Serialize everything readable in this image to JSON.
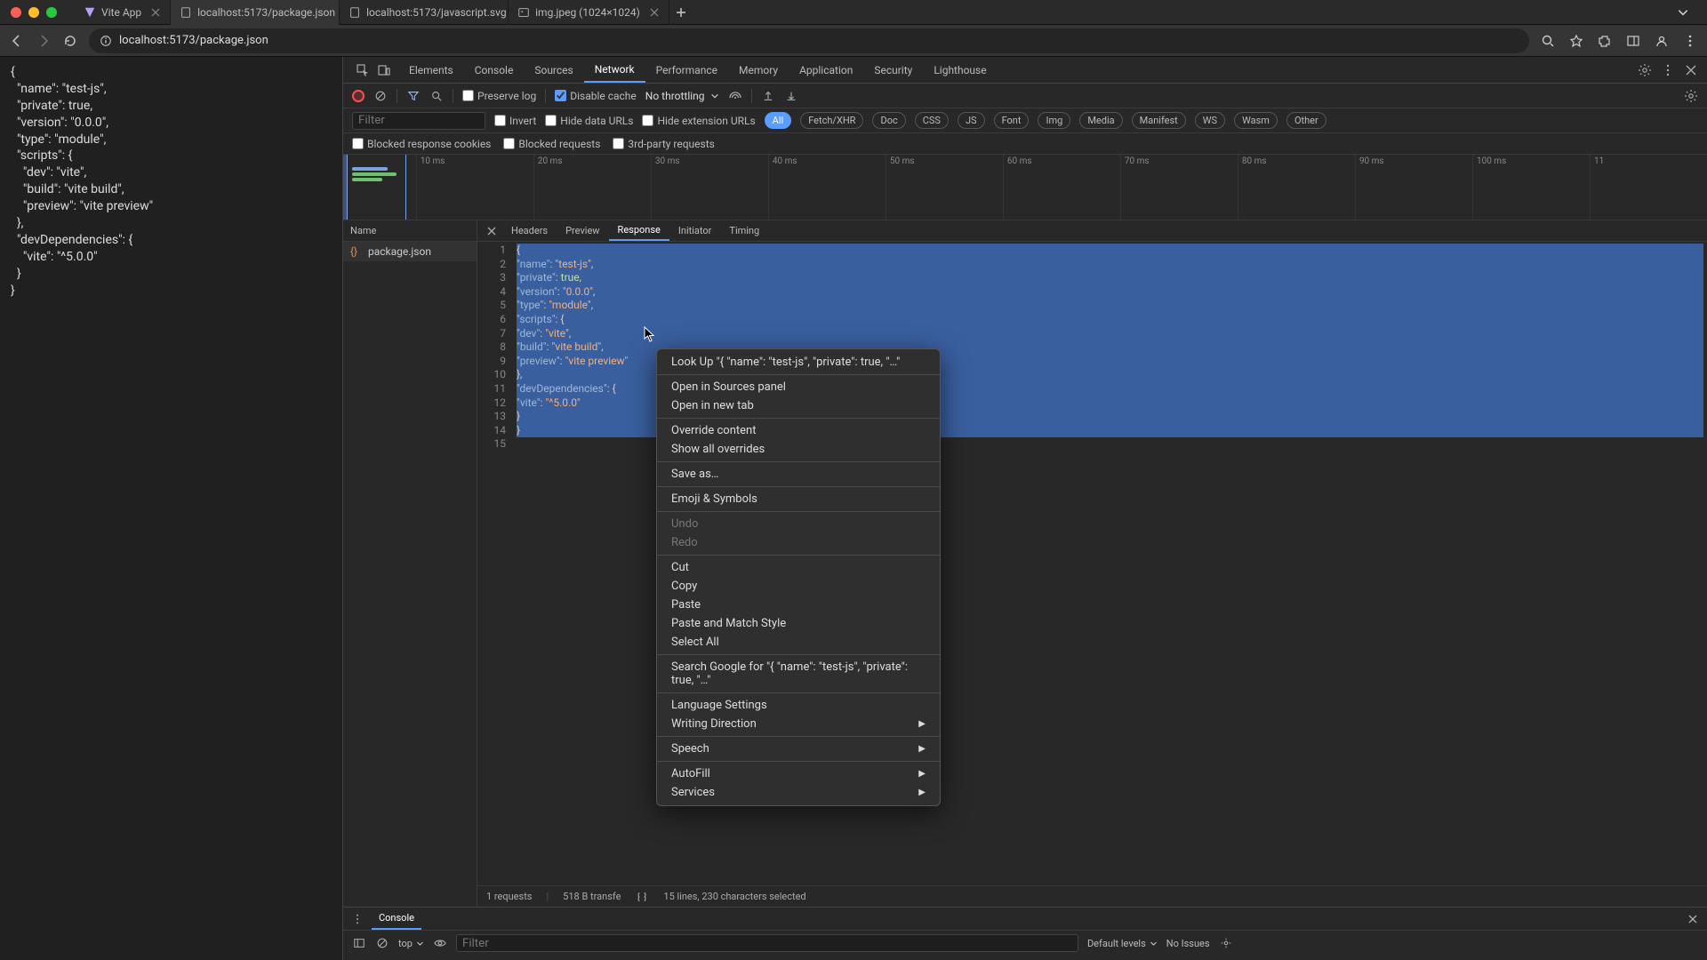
{
  "browser": {
    "tabs": [
      {
        "label": "Vite App",
        "active": false
      },
      {
        "label": "localhost:5173/package.json",
        "active": true
      },
      {
        "label": "localhost:5173/javascript.svg",
        "active": false
      },
      {
        "label": "img.jpeg (1024×1024)",
        "active": false
      }
    ],
    "url": "localhost:5173/package.json"
  },
  "page_content": "{\n  \"name\": \"test-js\",\n  \"private\": true,\n  \"version\": \"0.0.0\",\n  \"type\": \"module\",\n  \"scripts\": {\n    \"dev\": \"vite\",\n    \"build\": \"vite build\",\n    \"preview\": \"vite preview\"\n  },\n  \"devDependencies\": {\n    \"vite\": \"^5.0.0\"\n  }\n}",
  "devtools": {
    "panels": [
      "Elements",
      "Console",
      "Sources",
      "Network",
      "Performance",
      "Memory",
      "Application",
      "Security",
      "Lighthouse"
    ],
    "active_panel": "Network",
    "network": {
      "preserve_log": false,
      "disable_cache": true,
      "throttling": "No throttling",
      "filter_placeholder": "Filter",
      "invert": false,
      "hide_data_urls": false,
      "hide_ext_urls": false,
      "types": [
        "All",
        "Fetch/XHR",
        "Doc",
        "CSS",
        "JS",
        "Font",
        "Img",
        "Media",
        "Manifest",
        "WS",
        "Wasm",
        "Other"
      ],
      "active_type": "All",
      "blocked_cookies": false,
      "blocked_requests": false,
      "third_party": false,
      "ticks": [
        "10 ms",
        "20 ms",
        "30 ms",
        "40 ms",
        "50 ms",
        "60 ms",
        "70 ms",
        "80 ms",
        "90 ms",
        "100 ms",
        "11"
      ],
      "name_header": "Name",
      "requests": [
        {
          "name": "package.json"
        }
      ],
      "detail_tabs": [
        "Headers",
        "Preview",
        "Response",
        "Initiator",
        "Timing"
      ],
      "active_detail_tab": "Response",
      "response_lines": [
        "{",
        "  \"name\": \"test-js\",",
        "  \"private\": true,",
        "  \"version\": \"0.0.0\",",
        "  \"type\": \"module\",",
        "  \"scripts\": {",
        "    \"dev\": \"vite\",",
        "    \"build\": \"vite build\",",
        "    \"preview\": \"vite preview\"",
        "  },",
        "  \"devDependencies\": {",
        "    \"vite\": \"^5.0.0\"",
        "  }",
        "}",
        ""
      ],
      "status": {
        "requests": "1 requests",
        "transfer": "518 B transfe",
        "selection": "15 lines, 230 characters selected"
      }
    },
    "console": {
      "tab": "Console",
      "scope": "top",
      "filter_placeholder": "Filter",
      "levels": "Default levels",
      "issues": "No Issues"
    }
  },
  "context_menu": {
    "lookup": "Look Up \"{   \"name\": \"test-js\",   \"private\": true,   \"…\"",
    "open_sources": "Open in Sources panel",
    "open_new_tab": "Open in new tab",
    "override_content": "Override content",
    "show_overrides": "Show all overrides",
    "save_as": "Save as…",
    "emoji": "Emoji & Symbols",
    "undo": "Undo",
    "redo": "Redo",
    "cut": "Cut",
    "copy": "Copy",
    "paste": "Paste",
    "paste_match": "Paste and Match Style",
    "select_all": "Select All",
    "search_google": "Search Google for \"{   \"name\": \"test-js\",   \"private\": true,   \"…\"",
    "language": "Language Settings",
    "writing_dir": "Writing Direction",
    "speech": "Speech",
    "autofill": "AutoFill",
    "services": "Services"
  }
}
